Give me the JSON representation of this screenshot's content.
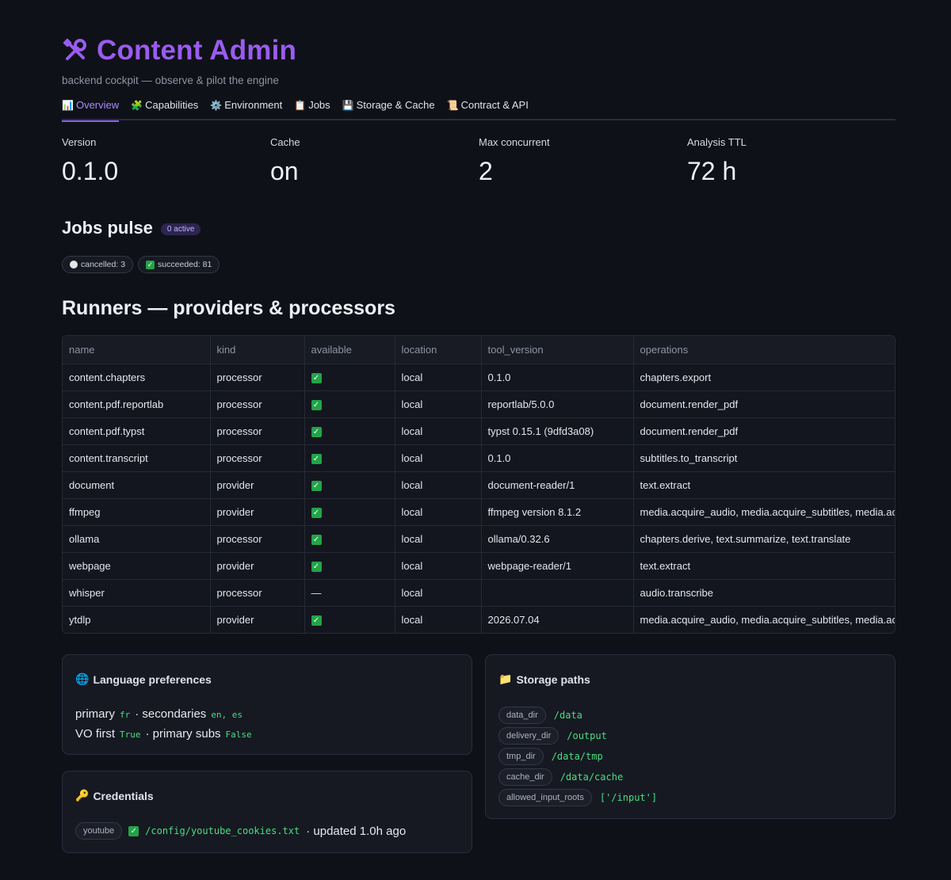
{
  "header": {
    "title": "Content Admin",
    "subtitle": "backend cockpit — observe & pilot the engine",
    "title_icon": "tools-icon",
    "title_color": "#9a5cf0"
  },
  "tabs": [
    {
      "icon": "📊",
      "label": "Overview",
      "active": true
    },
    {
      "icon": "🧩",
      "label": "Capabilities"
    },
    {
      "icon": "⚙️",
      "label": "Environment"
    },
    {
      "icon": "📋",
      "label": "Jobs"
    },
    {
      "icon": "💾",
      "label": "Storage & Cache"
    },
    {
      "icon": "📜",
      "label": "Contract & API"
    }
  ],
  "metrics": [
    {
      "label": "Version",
      "value": "0.1.0"
    },
    {
      "label": "Cache",
      "value": "on"
    },
    {
      "label": "Max concurrent",
      "value": "2"
    },
    {
      "label": "Analysis TTL",
      "value": "72 h"
    }
  ],
  "jobs": {
    "title": "Jobs pulse",
    "active_badge": "0 active",
    "cancelled": "cancelled: 3",
    "succeeded": "succeeded: 81"
  },
  "runners": {
    "title": "Runners — providers & processors",
    "columns": [
      "name",
      "kind",
      "available",
      "location",
      "tool_version",
      "operations"
    ],
    "rows": [
      [
        "content.chapters",
        "processor",
        "✓",
        "local",
        "0.1.0",
        "chapters.export"
      ],
      [
        "content.pdf.reportlab",
        "processor",
        "✓",
        "local",
        "reportlab/5.0.0",
        "document.render_pdf"
      ],
      [
        "content.pdf.typst",
        "processor",
        "✓",
        "local",
        "typst 0.15.1 (9dfd3a08)",
        "document.render_pdf"
      ],
      [
        "content.transcript",
        "processor",
        "✓",
        "local",
        "0.1.0",
        "subtitles.to_transcript"
      ],
      [
        "document",
        "provider",
        "✓",
        "local",
        "document-reader/1",
        "text.extract"
      ],
      [
        "ffmpeg",
        "provider",
        "✓",
        "local",
        "ffmpeg version 8.1.2",
        "media.acquire_audio, media.acquire_subtitles, media.ac"
      ],
      [
        "ollama",
        "processor",
        "✓",
        "local",
        "ollama/0.32.6",
        "chapters.derive, text.summarize, text.translate"
      ],
      [
        "webpage",
        "provider",
        "✓",
        "local",
        "webpage-reader/1",
        "text.extract"
      ],
      [
        "whisper",
        "processor",
        "—",
        "local",
        "",
        "audio.transcribe"
      ],
      [
        "ytdlp",
        "provider",
        "✓",
        "local",
        "2026.07.04",
        "media.acquire_audio, media.acquire_subtitles, media.ac"
      ]
    ]
  },
  "language": {
    "title": "Language preferences",
    "icon": "🌐",
    "primary_label": "primary",
    "primary_value": "fr",
    "secondaries_label": "· secondaries",
    "secondaries_value": "en, es",
    "vo_label": "VO first",
    "vo_value": "True",
    "subs_label": "· primary subs",
    "subs_value": "False"
  },
  "credentials": {
    "title": "Credentials",
    "icon": "🔑",
    "service": "youtube",
    "path": "/config/youtube_cookies.txt",
    "updated": "· updated 1.0h ago"
  },
  "storage": {
    "title": "Storage paths",
    "icon": "📁",
    "paths": [
      {
        "key": "data_dir",
        "value": "/data"
      },
      {
        "key": "delivery_dir",
        "value": "/output"
      },
      {
        "key": "tmp_dir",
        "value": "/data/tmp"
      },
      {
        "key": "cache_dir",
        "value": "/data/cache"
      },
      {
        "key": "allowed_input_roots",
        "value": "['/input']"
      }
    ]
  }
}
